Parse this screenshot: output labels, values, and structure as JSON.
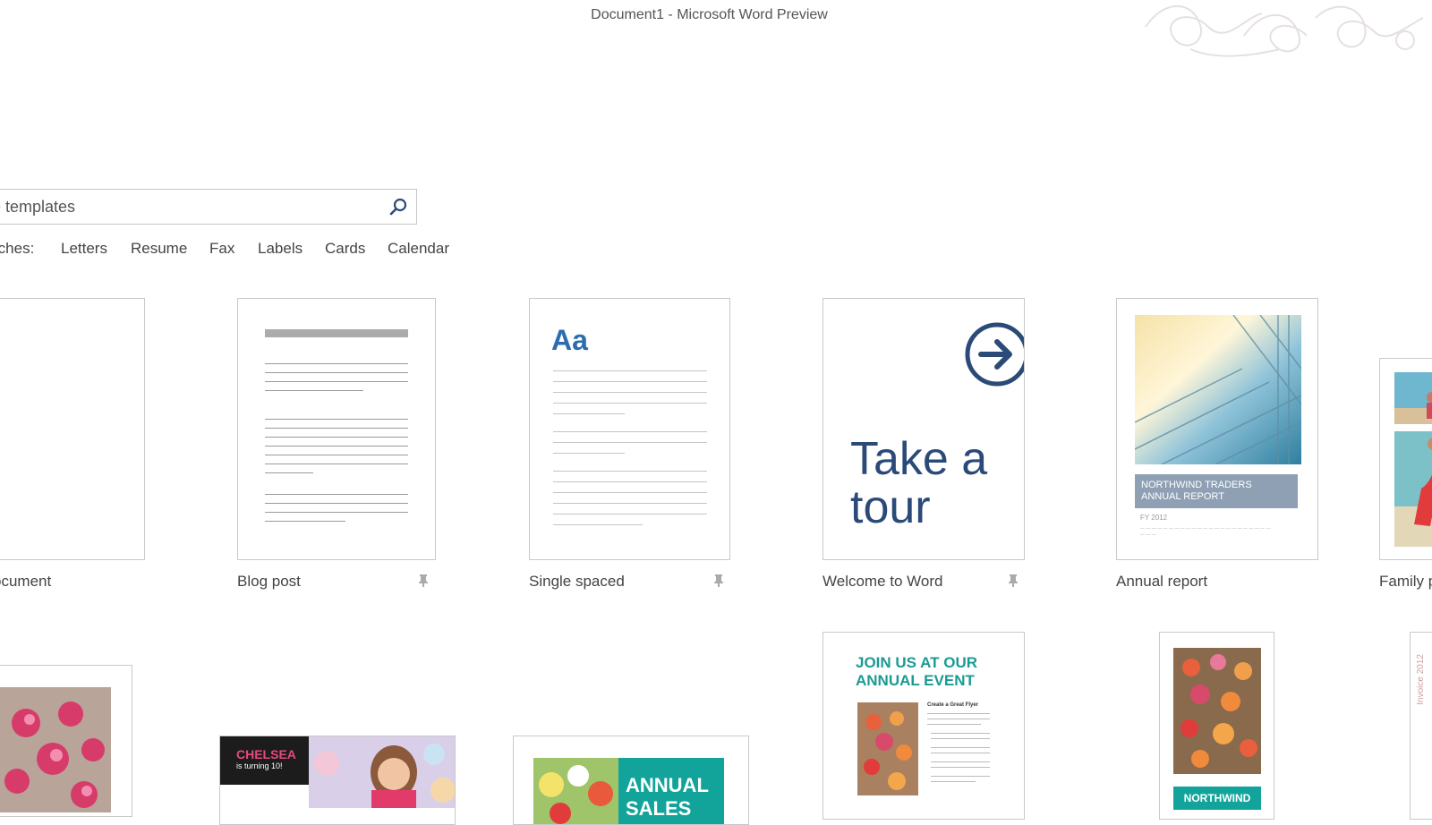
{
  "window": {
    "title": "Document1 - Microsoft Word Preview"
  },
  "search": {
    "value": "e templates",
    "placeholder": "Search for online templates"
  },
  "suggested": {
    "label": "rches:",
    "items": [
      "Letters",
      "Resume",
      "Fax",
      "Labels",
      "Cards",
      "Calendar"
    ]
  },
  "templates": {
    "blank_caption": "ocument",
    "blog_caption": "Blog post",
    "single_caption": "Single spaced",
    "single_sample": "Aa",
    "tour_caption": "Welcome to Word",
    "tour_text_1": "Take a",
    "tour_text_2": "tour",
    "annual_caption": "Annual report",
    "annual_band": "NORTHWIND TRADERS ANNUAL REPORT",
    "annual_fy": "FY 2012",
    "family_caption": "Family p"
  },
  "row2": {
    "chelsea_name": "CHELSEA",
    "chelsea_sub": "is turning 10!",
    "annual_sales": "ANNUAL",
    "annual_sales2": "SALES",
    "event_title_1": "JOIN US AT OUR",
    "event_title_2": "ANNUAL EVENT",
    "event_sub": "Create a Great Flyer",
    "northwind": "NORTHWIND",
    "invoice": "Invoice 2012"
  },
  "colors": {
    "accent": "#2b4a78",
    "teal": "#12a49a"
  }
}
